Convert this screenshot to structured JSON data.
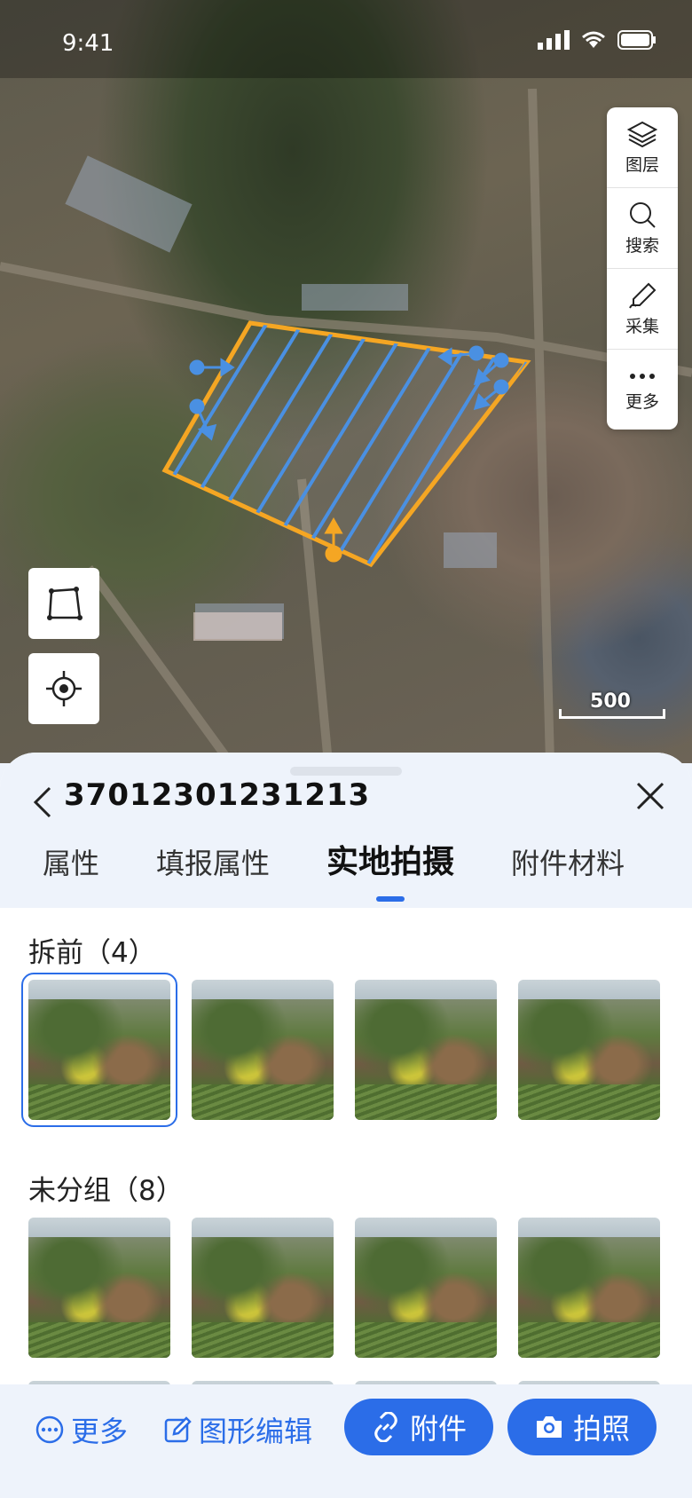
{
  "status_bar": {
    "time": "9:41"
  },
  "map": {
    "tools": [
      {
        "icon": "layers-icon",
        "label": "图层"
      },
      {
        "icon": "search-icon",
        "label": "搜索"
      },
      {
        "icon": "pen-icon",
        "label": "采集"
      },
      {
        "icon": "more-dots-icon",
        "label": "更多"
      }
    ],
    "scale_label": "500",
    "polygon_color": "#f5a623",
    "hatch_color": "#4a90e2"
  },
  "sheet": {
    "title": "37012301231213",
    "tabs": [
      "属性",
      "填报属性",
      "实地拍摄",
      "附件材料"
    ],
    "active_tab": "实地拍摄",
    "groups": [
      {
        "label": "拆前（4）",
        "count": 4
      },
      {
        "label": "未分组（8）",
        "count": 8
      }
    ]
  },
  "bottom_bar": {
    "more_label": "更多",
    "edit_label": "图形编辑",
    "attach_label": "附件",
    "photo_label": "拍照"
  },
  "colors": {
    "accent": "#2b6de8"
  }
}
